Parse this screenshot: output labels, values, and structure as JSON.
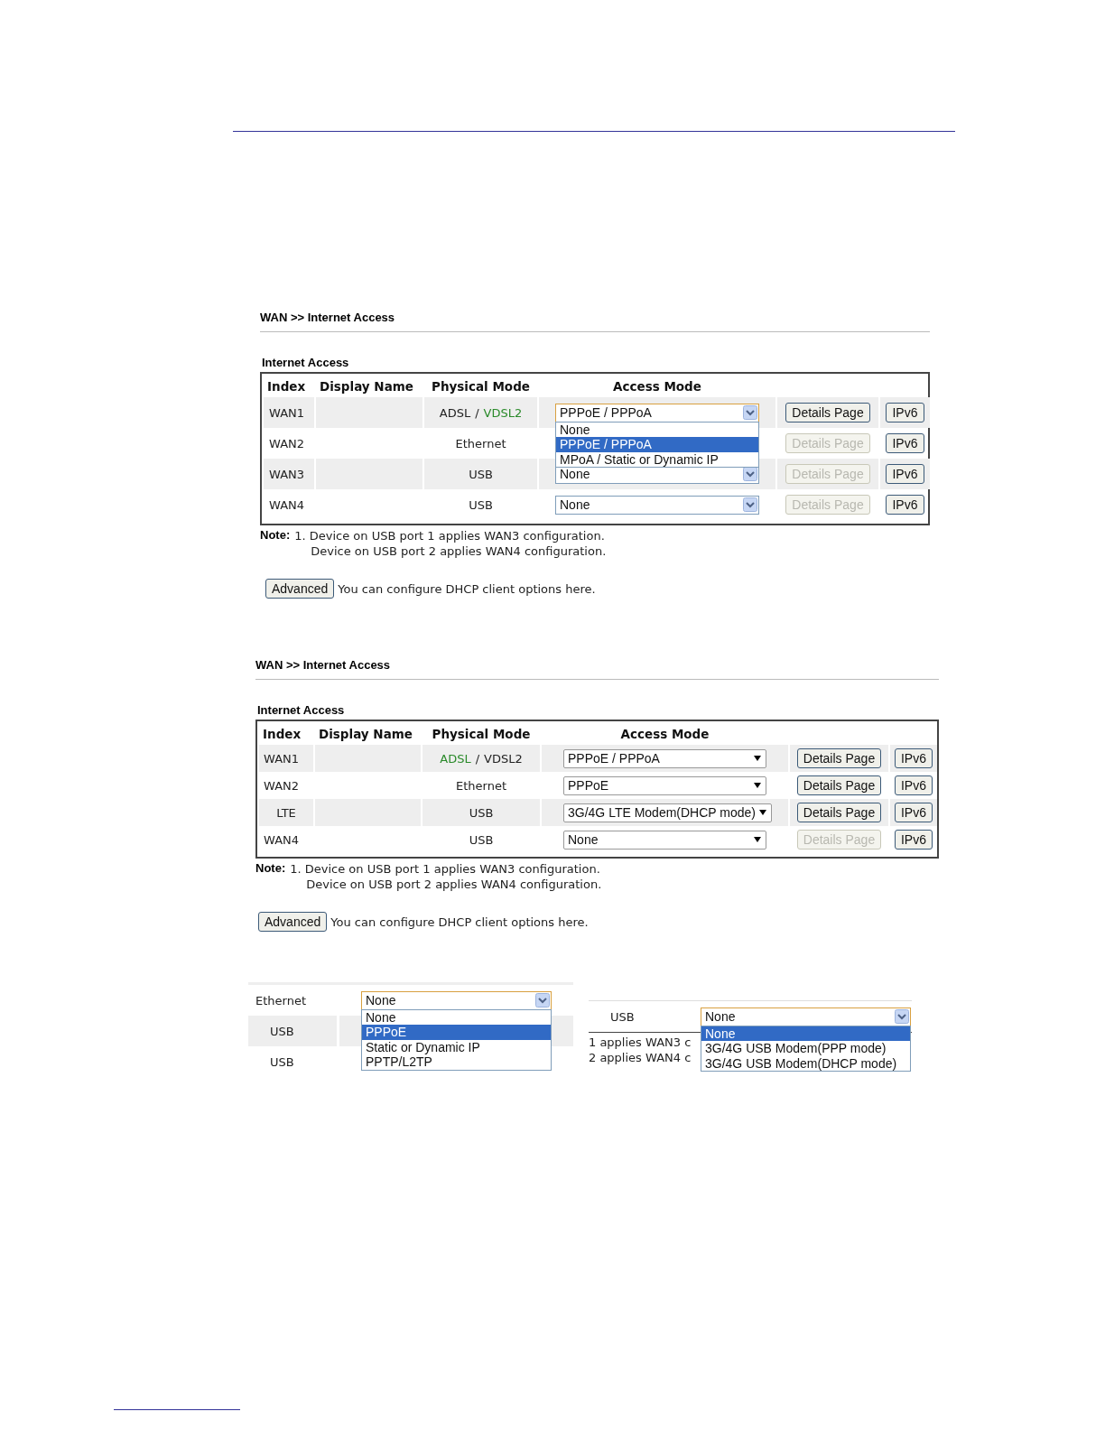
{
  "panels": [
    {
      "breadcrumb": "WAN >> Internet Access",
      "section_title": "Internet Access",
      "kind": "combo",
      "columns": [
        "Index",
        "Display Name",
        "Physical Mode",
        "Access Mode"
      ],
      "rows": [
        {
          "index": "WAN1",
          "physical_mode": [
            {
              "text": "ADSL",
              "active": false
            },
            {
              "text": "VDSL2",
              "active": true
            }
          ],
          "separator": "/",
          "access_mode": "PPPoE / PPPoA",
          "focused": true,
          "details": "Details Page",
          "details_disabled": false,
          "ipv6": "IPv6",
          "menu": {
            "options": [
              {
                "label": "None",
                "selected": false
              },
              {
                "label": "PPPoE / PPPoA",
                "selected": true
              },
              {
                "label": "MPoA / Static or Dynamic IP",
                "selected": false
              }
            ]
          }
        },
        {
          "index": "WAN2",
          "physical_mode": [
            {
              "text": "Ethernet",
              "active": false
            }
          ],
          "details": "Details Page",
          "details_disabled": true,
          "ipv6": "IPv6"
        },
        {
          "index": "WAN3",
          "physical_mode": [
            {
              "text": "USB",
              "active": false
            }
          ],
          "access_mode": "None",
          "focused": false,
          "details": "Details Page",
          "details_disabled": true,
          "ipv6": "IPv6"
        },
        {
          "index": "WAN4",
          "physical_mode": [
            {
              "text": "USB",
              "active": false
            }
          ],
          "access_mode": "None",
          "focused": false,
          "details": "Details Page",
          "details_disabled": true,
          "ipv6": "IPv6"
        }
      ],
      "note_label": "Note:",
      "notes": [
        "1. Device on USB port 1 applies WAN3 configuration.",
        "Device on USB port 2 applies WAN4 configuration."
      ],
      "advanced_button": "Advanced",
      "advanced_text": "You can configure DHCP client options here."
    },
    {
      "breadcrumb": "WAN >> Internet Access",
      "section_title": "Internet Access",
      "kind": "plain",
      "columns": [
        "Index",
        "Display Name",
        "Physical Mode",
        "Access Mode"
      ],
      "rows": [
        {
          "index": "WAN1",
          "physical_mode": [
            {
              "text": "ADSL",
              "active": true
            },
            {
              "text": "VDSL2",
              "active": false
            }
          ],
          "separator": "/",
          "access_mode": "PPPoE / PPPoA",
          "focused": false,
          "details": "Details Page",
          "details_disabled": false,
          "ipv6": "IPv6"
        },
        {
          "index": "WAN2",
          "physical_mode": [
            {
              "text": "Ethernet",
              "active": false
            }
          ],
          "access_mode": "PPPoE",
          "focused": false,
          "details": "Details Page",
          "details_disabled": false,
          "ipv6": "IPv6"
        },
        {
          "index": "LTE",
          "physical_mode": [
            {
              "text": "USB",
              "active": false
            }
          ],
          "access_mode": "3G/4G LTE Modem(DHCP mode)",
          "focused": false,
          "details": "Details Page",
          "details_disabled": false,
          "ipv6": "IPv6"
        },
        {
          "index": "WAN4",
          "physical_mode": [
            {
              "text": "USB",
              "active": false
            }
          ],
          "access_mode": "None",
          "focused": false,
          "details": "Details Page",
          "details_disabled": true,
          "ipv6": "IPv6"
        }
      ],
      "note_label": "Note:",
      "notes": [
        "1. Device on USB port 1 applies WAN3 configuration.",
        "Device on USB port 2 applies WAN4 configuration."
      ],
      "advanced_button": "Advanced",
      "advanced_text": "You can configure DHCP client options here."
    }
  ],
  "crops": [
    {
      "rows": [
        {
          "label": "Ethernet",
          "value": "None",
          "menu": {
            "options": [
              {
                "label": "None",
                "selected": false
              },
              {
                "label": "PPPoE",
                "selected": true
              },
              {
                "label": "Static or Dynamic IP",
                "selected": false
              },
              {
                "label": "PPTP/L2TP",
                "selected": false
              }
            ]
          }
        },
        {
          "label": "USB"
        },
        {
          "label": "USB"
        }
      ]
    },
    {
      "rows": [
        {
          "label": "USB",
          "value": "None",
          "menu": {
            "options": [
              {
                "label": "None",
                "selected": true
              },
              {
                "label": "3G/4G USB Modem(PPP mode)",
                "selected": false
              },
              {
                "label": "3G/4G USB Modem(DHCP mode)",
                "selected": false
              }
            ]
          }
        }
      ],
      "notes": [
        "1 applies WAN3 c",
        "2 applies WAN4 c"
      ]
    }
  ]
}
